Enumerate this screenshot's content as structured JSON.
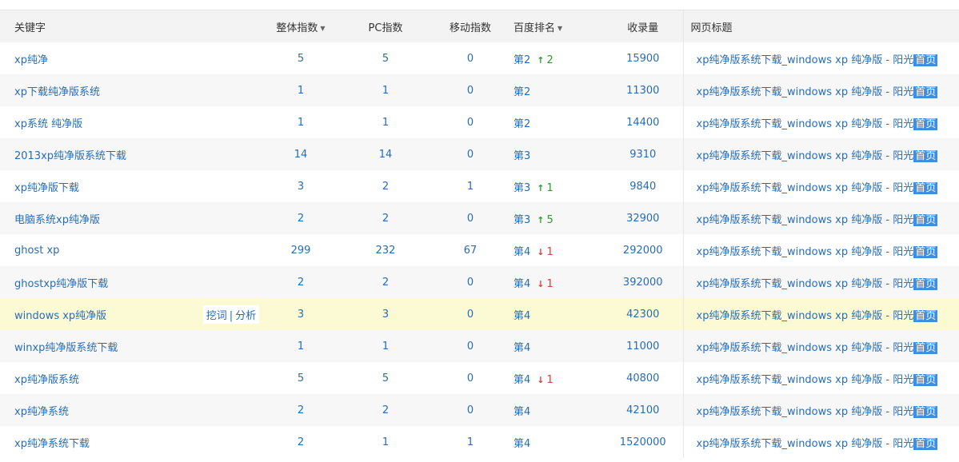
{
  "headers": {
    "keyword": "关键字",
    "total_index": "整体指数",
    "pc_index": "PC指数",
    "mobile_index": "移动指数",
    "baidu_rank": "百度排名",
    "indexed": "收录量",
    "page_title": "网页标题"
  },
  "actions": {
    "dig": "挖词",
    "sep": "|",
    "analyze": "分析"
  },
  "title_text": "xp纯净版系统下载_windows xp 纯净版 - 阳光",
  "home_badge": "首页",
  "colors": {
    "link": "#2a6cb0",
    "up": "#2e9a2e",
    "down": "#d43f3a",
    "badge": "#3e8fe0",
    "highlight_row": "#fcfad4"
  },
  "rows": [
    {
      "keyword": "xp纯净",
      "total": "5",
      "pc": "5",
      "mobile": "0",
      "rank": "第2",
      "change_dir": "up",
      "change": "2",
      "indexed": "15900"
    },
    {
      "keyword": "xp下载纯净版系统",
      "total": "1",
      "pc": "1",
      "mobile": "0",
      "rank": "第2",
      "change_dir": "",
      "change": "",
      "indexed": "11300"
    },
    {
      "keyword": "xp系统 纯净版",
      "total": "1",
      "pc": "1",
      "mobile": "0",
      "rank": "第2",
      "change_dir": "",
      "change": "",
      "indexed": "14400"
    },
    {
      "keyword": "2013xp纯净版系统下载",
      "total": "14",
      "pc": "14",
      "mobile": "0",
      "rank": "第3",
      "change_dir": "",
      "change": "",
      "indexed": "9310"
    },
    {
      "keyword": "xp纯净版下载",
      "total": "3",
      "pc": "2",
      "mobile": "1",
      "rank": "第3",
      "change_dir": "up",
      "change": "1",
      "indexed": "9840"
    },
    {
      "keyword": "电脑系统xp纯净版",
      "total": "2",
      "pc": "2",
      "mobile": "0",
      "rank": "第3",
      "change_dir": "up",
      "change": "5",
      "indexed": "32900"
    },
    {
      "keyword": "ghost xp",
      "total": "299",
      "pc": "232",
      "mobile": "67",
      "rank": "第4",
      "change_dir": "down",
      "change": "1",
      "indexed": "292000"
    },
    {
      "keyword": "ghostxp纯净版下载",
      "total": "2",
      "pc": "2",
      "mobile": "0",
      "rank": "第4",
      "change_dir": "down",
      "change": "1",
      "indexed": "392000"
    },
    {
      "keyword": "windows xp纯净版",
      "total": "3",
      "pc": "3",
      "mobile": "0",
      "rank": "第4",
      "change_dir": "",
      "change": "",
      "indexed": "42300",
      "highlighted": true
    },
    {
      "keyword": "winxp纯净版系统下载",
      "total": "1",
      "pc": "1",
      "mobile": "0",
      "rank": "第4",
      "change_dir": "",
      "change": "",
      "indexed": "11000"
    },
    {
      "keyword": "xp纯净版系统",
      "total": "5",
      "pc": "5",
      "mobile": "0",
      "rank": "第4",
      "change_dir": "down",
      "change": "1",
      "indexed": "40800"
    },
    {
      "keyword": "xp纯净系统",
      "total": "2",
      "pc": "2",
      "mobile": "0",
      "rank": "第4",
      "change_dir": "",
      "change": "",
      "indexed": "42100"
    },
    {
      "keyword": "xp纯净系统下载",
      "total": "2",
      "pc": "1",
      "mobile": "1",
      "rank": "第4",
      "change_dir": "",
      "change": "",
      "indexed": "1520000"
    }
  ]
}
